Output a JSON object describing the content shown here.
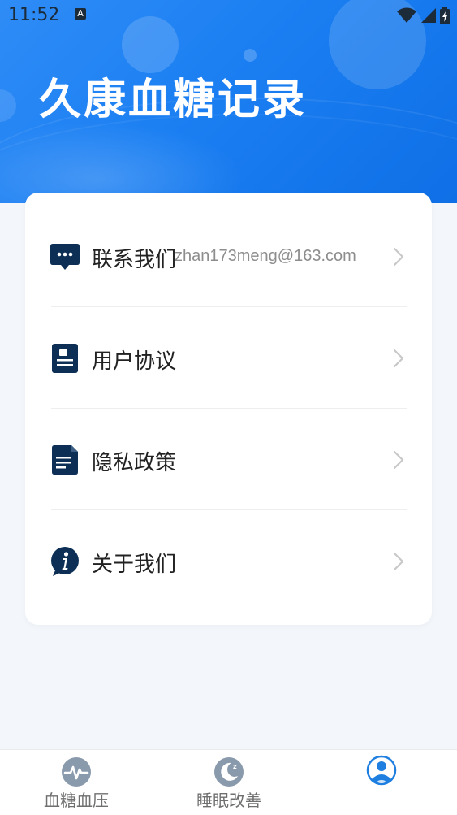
{
  "status_bar": {
    "time": "11:52",
    "notification_badge": "A"
  },
  "header": {
    "title": "久康血糖记录"
  },
  "menu": {
    "items": [
      {
        "label": "联系我们",
        "value": "zhan173meng@163.com",
        "icon": "chat-bubble-icon"
      },
      {
        "label": "用户协议",
        "value": "",
        "icon": "document-icon"
      },
      {
        "label": "隐私政策",
        "value": "",
        "icon": "policy-document-icon"
      },
      {
        "label": "关于我们",
        "value": "",
        "icon": "info-icon"
      }
    ]
  },
  "tabbar": {
    "tabs": [
      {
        "label": "血糖血压",
        "icon": "pulse-icon",
        "active": false
      },
      {
        "label": "睡眠改善",
        "icon": "moon-icon",
        "active": false
      },
      {
        "label": "",
        "icon": "user-profile-icon",
        "active": true
      }
    ]
  },
  "colors": {
    "header_blue": "#1b7ff2",
    "icon_navy": "#0d2f55",
    "tab_gray": "#8a9aad",
    "active_blue": "#1e7fe0"
  }
}
